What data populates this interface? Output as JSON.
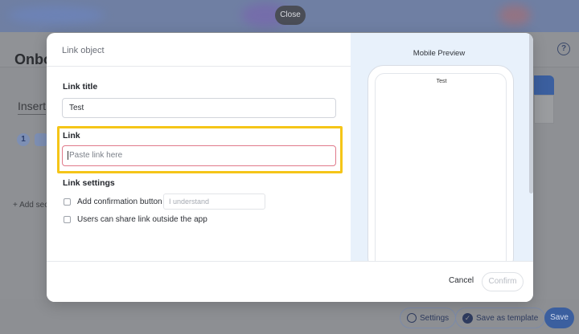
{
  "background": {
    "title": "Onbo",
    "insert_label": "Insert",
    "step_number": "1",
    "add_section": "+ Add sec",
    "help_icon": "question-icon",
    "bottom_bar": {
      "settings_label": "Settings",
      "save_template_label": "Save as template",
      "save_label": "Save"
    }
  },
  "close_button": {
    "label": "Close"
  },
  "modal": {
    "header_title": "Link object",
    "link_title": {
      "label": "Link title",
      "value": "Test"
    },
    "link": {
      "label": "Link",
      "placeholder": "Paste link here"
    },
    "link_settings": {
      "label": "Link settings",
      "confirmation": {
        "label": "Add confirmation button",
        "checked": false,
        "input_placeholder": "I understand"
      },
      "share": {
        "label": "Users can share link outside the app",
        "checked": false
      }
    },
    "preview": {
      "title": "Mobile Preview",
      "phone_title": "Test"
    },
    "footer": {
      "cancel_label": "Cancel",
      "confirm_label": "Confirm"
    }
  },
  "colors": {
    "highlight": "#f5c518",
    "link_input_border": "#e07a8b",
    "preview_bg": "#e8f1fb",
    "primary": "#3b5f9f"
  }
}
